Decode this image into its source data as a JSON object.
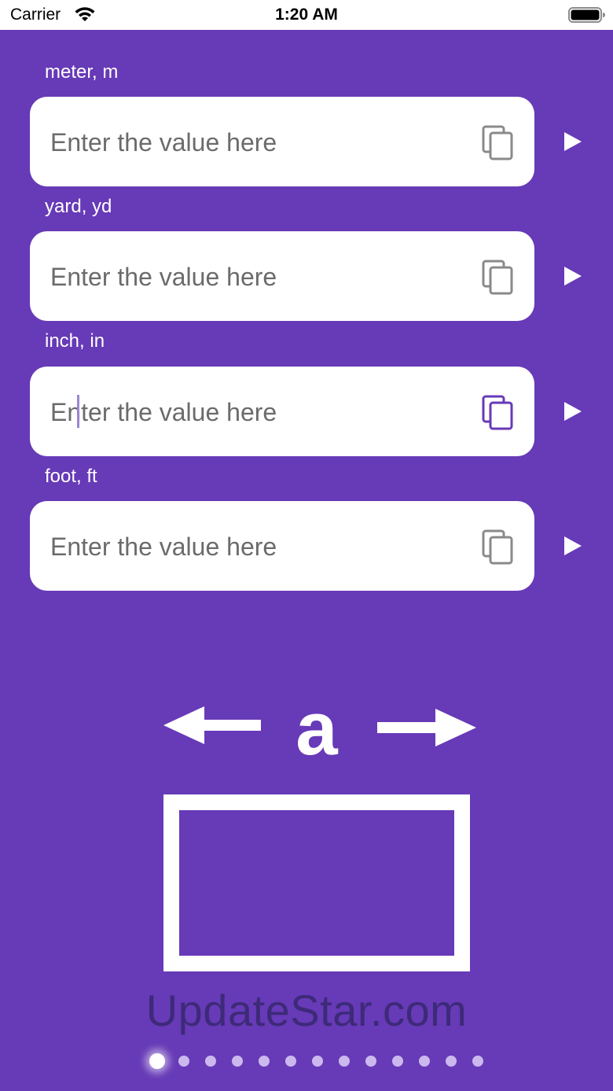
{
  "status_bar": {
    "carrier": "Carrier",
    "time": "1:20 AM"
  },
  "converter": {
    "rows": [
      {
        "label": "meter, m",
        "placeholder": "Enter the value here",
        "value": "",
        "focused": false
      },
      {
        "label": "yard, yd",
        "placeholder": "Enter the value here",
        "value": "",
        "focused": false
      },
      {
        "label": "inch, in",
        "placeholder": "Enter the value here",
        "value": "",
        "focused": true
      },
      {
        "label": "foot, ft",
        "placeholder": "Enter the value here",
        "value": "",
        "focused": false
      }
    ]
  },
  "illustration": {
    "symbol": "a",
    "icon": "length-dimension-illustration"
  },
  "watermark": "UpdateStar.com",
  "pager": {
    "page_count": 13,
    "current_index": 0
  },
  "colors": {
    "background": "#673AB7",
    "field_background": "#FFFFFF",
    "copy_icon_default": "#8A8A8A",
    "copy_icon_focused": "#673AB7",
    "label_text": "#FFFFFF"
  }
}
